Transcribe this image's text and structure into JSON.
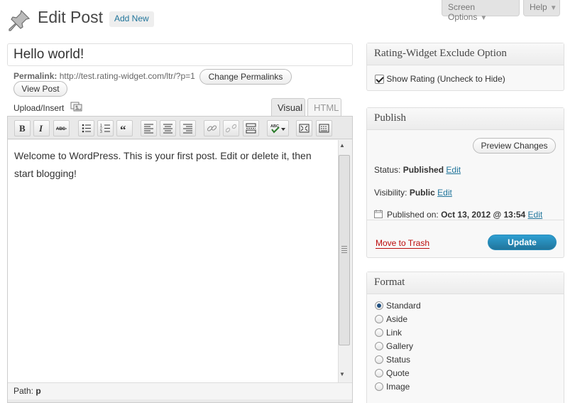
{
  "header": {
    "title": "Edit Post",
    "add_new": "Add New",
    "screen_options": "Screen Options",
    "help": "Help"
  },
  "post": {
    "title": "Hello world!",
    "permalink_label": "Permalink:",
    "permalink_url": "http://test.rating-widget.com/ltr/?p=1",
    "change_permalinks": "Change Permalinks",
    "view_post": "View Post"
  },
  "editor": {
    "upload_insert": "Upload/Insert",
    "tabs": [
      "Visual",
      "HTML"
    ],
    "active_tab": "Visual",
    "toolbar_icons": [
      "bold-icon",
      "italic-icon",
      "strikethrough-icon",
      "bullet-list-icon",
      "numbered-list-icon",
      "blockquote-icon",
      "align-left-icon",
      "align-center-icon",
      "align-right-icon",
      "link-icon",
      "unlink-icon",
      "more-tag-icon",
      "spellcheck-icon",
      "fullscreen-icon",
      "kitchen-sink-icon"
    ],
    "content": "Welcome to WordPress. This is your first post. Edit or delete it, then start blogging!",
    "path_label": "Path:",
    "path_value": "p"
  },
  "rating_widget": {
    "title": "Rating-Widget Exclude Option",
    "checkbox_label": "Show Rating (Uncheck to Hide)",
    "checked": true
  },
  "publish": {
    "title": "Publish",
    "preview_changes": "Preview Changes",
    "status_label": "Status:",
    "status_value": "Published",
    "visibility_label": "Visibility:",
    "visibility_value": "Public",
    "published_on_label": "Published on:",
    "published_on_value": "Oct 13, 2012 @ 13:54",
    "edit": "Edit",
    "move_to_trash": "Move to Trash",
    "update": "Update"
  },
  "format": {
    "title": "Format",
    "options": [
      "Standard",
      "Aside",
      "Link",
      "Gallery",
      "Status",
      "Quote",
      "Image"
    ],
    "selected": "Standard"
  },
  "colors": {
    "link": "#21759b",
    "update_button": "#21759b",
    "trash": "#bc0b0b"
  }
}
